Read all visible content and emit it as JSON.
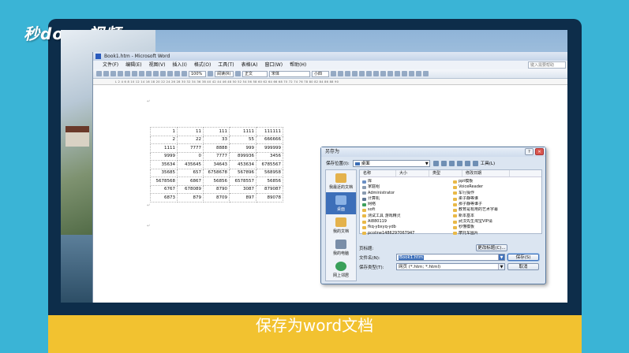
{
  "brand": {
    "logo_text": "秒dong视频"
  },
  "caption": "保存为word文档",
  "word": {
    "title": "Book1.htm - Microsoft Word",
    "menu": [
      "文件(F)",
      "编辑(E)",
      "视图(V)",
      "插入(I)",
      "格式(O)",
      "工具(T)",
      "表格(A)",
      "窗口(W)",
      "帮助(H)"
    ],
    "help_placeholder": "键入需要帮助",
    "zoom": "100%",
    "view_mode": "阅读(R)",
    "style": "正文",
    "font": "宋体",
    "size": "小四",
    "ruler": "L  2  4  6  8  10  12  14  16  18  20  22  24  26  28  30  32  34  36  38  40  42  44  46  48  50  52  54  56  58  60  62  64  66  68  70  72  74  76  78  80  82  84  86  88  90"
  },
  "table": {
    "rows": [
      [
        "1",
        "11",
        "111",
        "1111",
        "111111"
      ],
      [
        "2",
        "22",
        "33",
        "55",
        "666666"
      ],
      [
        "1111",
        "7777",
        "8888",
        "999",
        "999999"
      ],
      [
        "9999",
        "0",
        "7777",
        "899936",
        "3456"
      ],
      [
        "35634",
        "435645",
        "34643",
        "453634",
        "6785567"
      ],
      [
        "35685",
        "657",
        "6758678",
        "567896",
        "568958"
      ],
      [
        "5678568",
        "6867",
        "56856",
        "6578557",
        "56856"
      ],
      [
        "6767",
        "678089",
        "8790",
        "3087",
        "879087"
      ],
      [
        "6873",
        "879",
        "8709",
        "897",
        "89078"
      ]
    ]
  },
  "dialog": {
    "title": "另存为",
    "location_label": "保存位置(I):",
    "location_value": "桌面",
    "tools_label": "工具(L)",
    "places": [
      "我最近的文档",
      "桌面",
      "我的文档",
      "我的电脑",
      "网上邻居"
    ],
    "columns": [
      "名称",
      "大小",
      "类型",
      "修改日期"
    ],
    "files_left": [
      {
        "name": "库",
        "type": "lib"
      },
      {
        "name": "家庭组",
        "type": "usr"
      },
      {
        "name": "Administrator",
        "type": "usr"
      },
      {
        "name": "计算机",
        "type": "pc"
      },
      {
        "name": "网络",
        "type": "net"
      },
      {
        "name": "soft",
        "type": "folder"
      },
      {
        "name": "测试工具 游戏精灵",
        "type": "folder"
      },
      {
        "name": "AI880119",
        "type": "folder"
      },
      {
        "name": "fkq-ybxyq-ydb",
        "type": "folder"
      },
      {
        "name": "pcoline1486297067947",
        "type": "folder"
      }
    ],
    "files_right": [
      {
        "name": "ppt模板",
        "type": "folder"
      },
      {
        "name": "VoiceReader",
        "type": "folder"
      },
      {
        "name": "车行操作",
        "type": "folder"
      },
      {
        "name": "柔子静等谁",
        "type": "folder"
      },
      {
        "name": "那子静等谁子",
        "type": "folder"
      },
      {
        "name": "教育是有用的艺术字幕",
        "type": "folder"
      },
      {
        "name": "新本基本",
        "type": "folder"
      },
      {
        "name": "武汉先生淘宝VIP请",
        "type": "folder"
      },
      {
        "name": "秒懂模板",
        "type": "folder"
      },
      {
        "name": "摩托车图片",
        "type": "folder"
      }
    ],
    "page_title_label": "页标题:",
    "change_title_button": "更改标题(C)...",
    "filename_label": "文件名(N):",
    "filename_value": "Book1.htm",
    "filetype_label": "保存类型(T):",
    "filetype_value": "网页 (*.htm; *.html)",
    "save_button": "保存(S)",
    "cancel_button": "取消"
  }
}
